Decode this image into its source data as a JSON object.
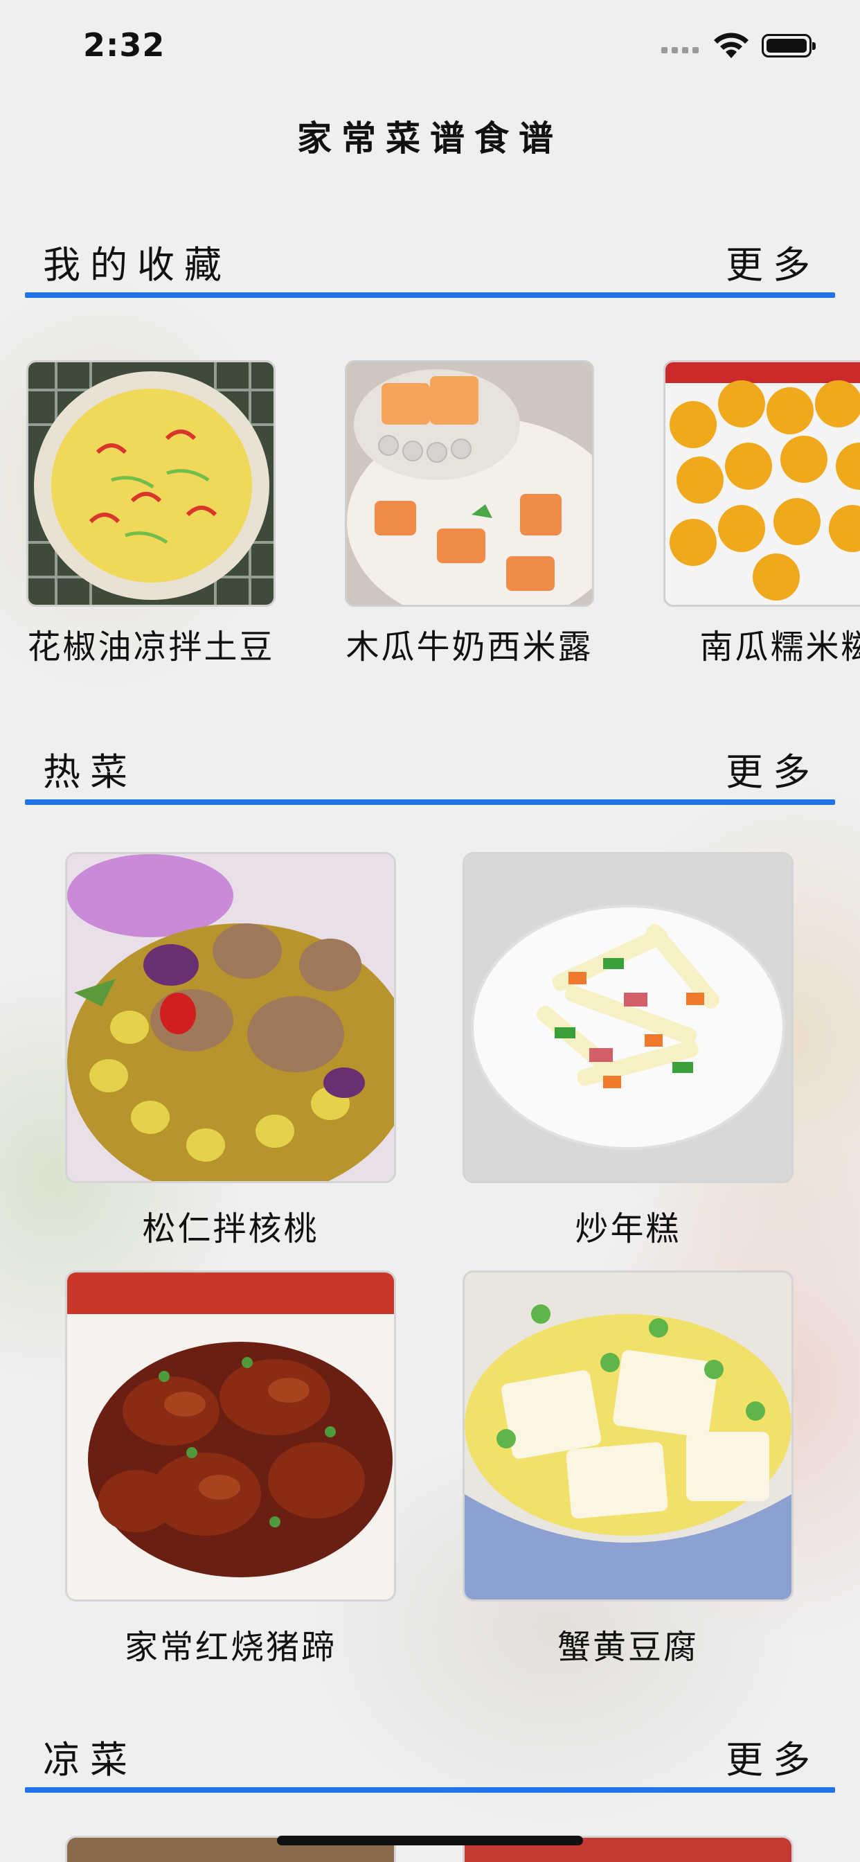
{
  "status": {
    "time": "2:32"
  },
  "header": {
    "title": "家常菜谱食谱"
  },
  "sections": {
    "favorites": {
      "title": "我的收藏",
      "more": "更多"
    },
    "hot": {
      "title": "热菜",
      "more": "更多"
    },
    "cold": {
      "title": "凉菜",
      "more": "更多"
    }
  },
  "favorites": [
    {
      "name": "花椒油凉拌土豆"
    },
    {
      "name": "木瓜牛奶西米露"
    },
    {
      "name": "南瓜糯米糍"
    }
  ],
  "hot_dishes": [
    {
      "name": "松仁拌核桃"
    },
    {
      "name": "炒年糕"
    },
    {
      "name": "家常红烧猪蹄"
    },
    {
      "name": "蟹黄豆腐"
    }
  ],
  "icons": [
    "cellular-signal-icon",
    "wifi-icon",
    "battery-icon"
  ],
  "colors": {
    "accent": "#1f74e8",
    "background": "#efefef"
  }
}
